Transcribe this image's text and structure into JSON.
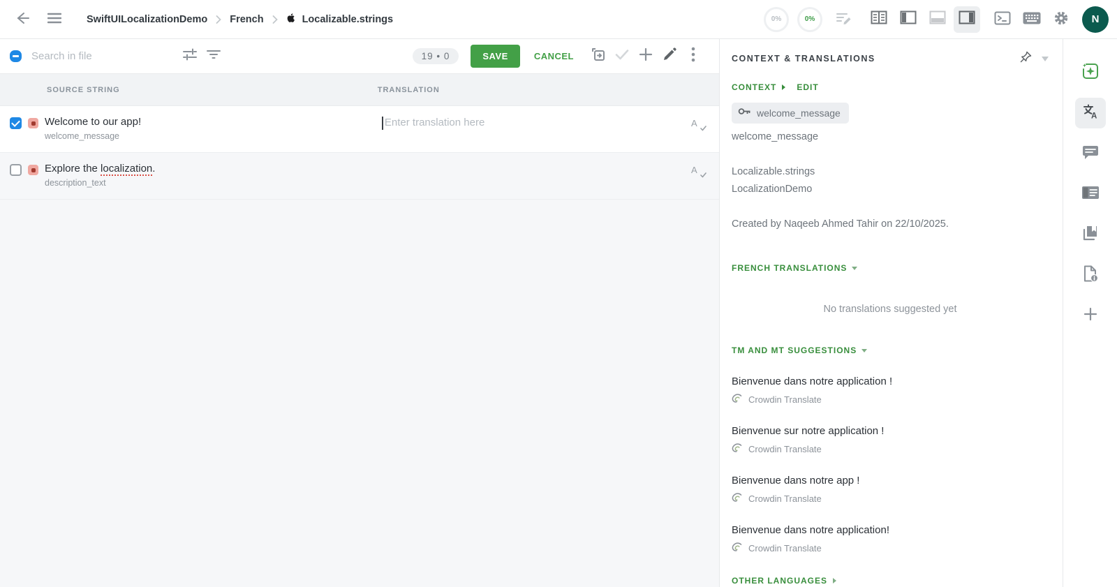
{
  "colors": {
    "accent_green": "#43a047",
    "link_green": "#388e3c",
    "checkbox_blue": "#1e88e5",
    "avatar_bg": "#0b5a4e",
    "status_red_bg": "#f0a8a1",
    "status_red_dot": "#a23b30"
  },
  "topbar": {
    "breadcrumb": {
      "project": "SwiftUILocalizationDemo",
      "language": "French",
      "file": "Localizable.strings"
    },
    "progress": [
      {
        "value": "0%"
      },
      {
        "value": "0%"
      }
    ],
    "avatar_initial": "N"
  },
  "toolbar": {
    "search_placeholder": "Search in file",
    "counter": "19 • 0",
    "save_label": "SAVE",
    "cancel_label": "CANCEL"
  },
  "table": {
    "columns": {
      "source": "SOURCE STRING",
      "translation": "TRANSLATION"
    },
    "rows": [
      {
        "source": "Welcome to our app!",
        "key": "welcome_message",
        "translation_placeholder": "Enter translation here"
      },
      {
        "source_prefix": "Explore the ",
        "source_misspelled": "localization",
        "source_suffix": ".",
        "key": "description_text"
      }
    ]
  },
  "sidebar": {
    "title": "CONTEXT & TRANSLATIONS",
    "context_label": "CONTEXT",
    "edit_label": "EDIT",
    "key_chip": "welcome_message",
    "key_name": "welcome_message",
    "file_name": "Localizable.strings",
    "project_name": "LocalizationDemo",
    "created_info": "Created by Naqeeb Ahmed Tahir on 22/10/2025.",
    "translations_section": "FRENCH TRANSLATIONS",
    "translations_empty": "No translations suggested yet",
    "suggestions_section": "TM AND MT SUGGESTIONS",
    "suggestions": [
      {
        "text": "Bienvenue dans notre application !",
        "provider": "Crowdin Translate"
      },
      {
        "text": "Bienvenue sur notre application !",
        "provider": "Crowdin Translate"
      },
      {
        "text": "Bienvenue dans notre app !",
        "provider": "Crowdin Translate"
      },
      {
        "text": "Bienvenue dans notre application!",
        "provider": "Crowdin Translate"
      }
    ],
    "other_languages_section": "OTHER LANGUAGES"
  }
}
